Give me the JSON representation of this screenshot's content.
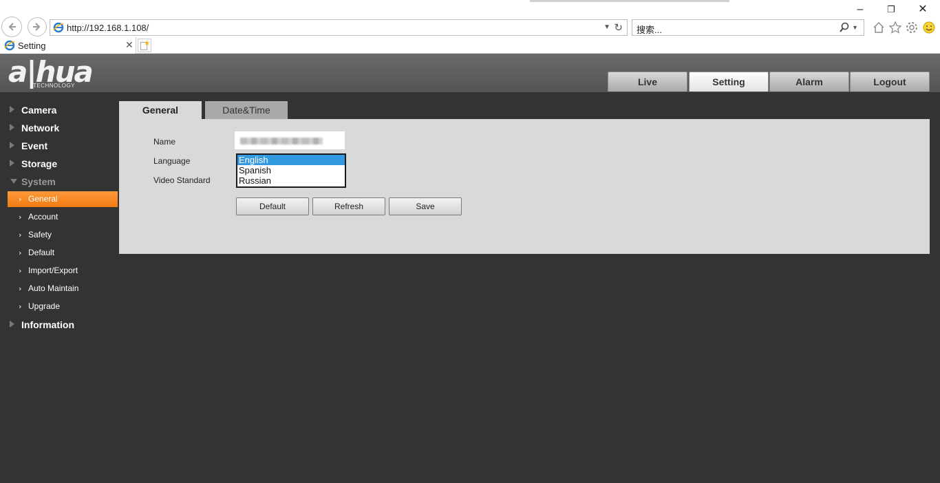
{
  "browser": {
    "url": "http://192.168.1.108/",
    "search_placeholder": "搜索...",
    "tab_title": "Setting"
  },
  "header": {
    "logo_text": "a|hua",
    "logo_sub": "TECHNOLOGY",
    "nav": [
      "Live",
      "Setting",
      "Alarm",
      "Logout"
    ],
    "active_nav": "Setting"
  },
  "sidebar": {
    "sections": [
      "Camera",
      "Network",
      "Event",
      "Storage",
      "System"
    ],
    "system_items": [
      "General",
      "Account",
      "Safety",
      "Default",
      "Import/Export",
      "Auto Maintain",
      "Upgrade"
    ],
    "last_section": "Information",
    "active_item": "General"
  },
  "content": {
    "tabs": [
      "General",
      "Date&Time"
    ],
    "fields": {
      "name_label": "Name",
      "language_label": "Language",
      "video_standard_label": "Video Standard"
    },
    "language_options": [
      "English",
      "Spanish",
      "Russian"
    ],
    "selected_language": "English",
    "buttons": [
      "Default",
      "Refresh",
      "Save"
    ]
  },
  "colors": {
    "accent": "#f58a1f",
    "selection": "#3399e0",
    "background": "#333333"
  }
}
